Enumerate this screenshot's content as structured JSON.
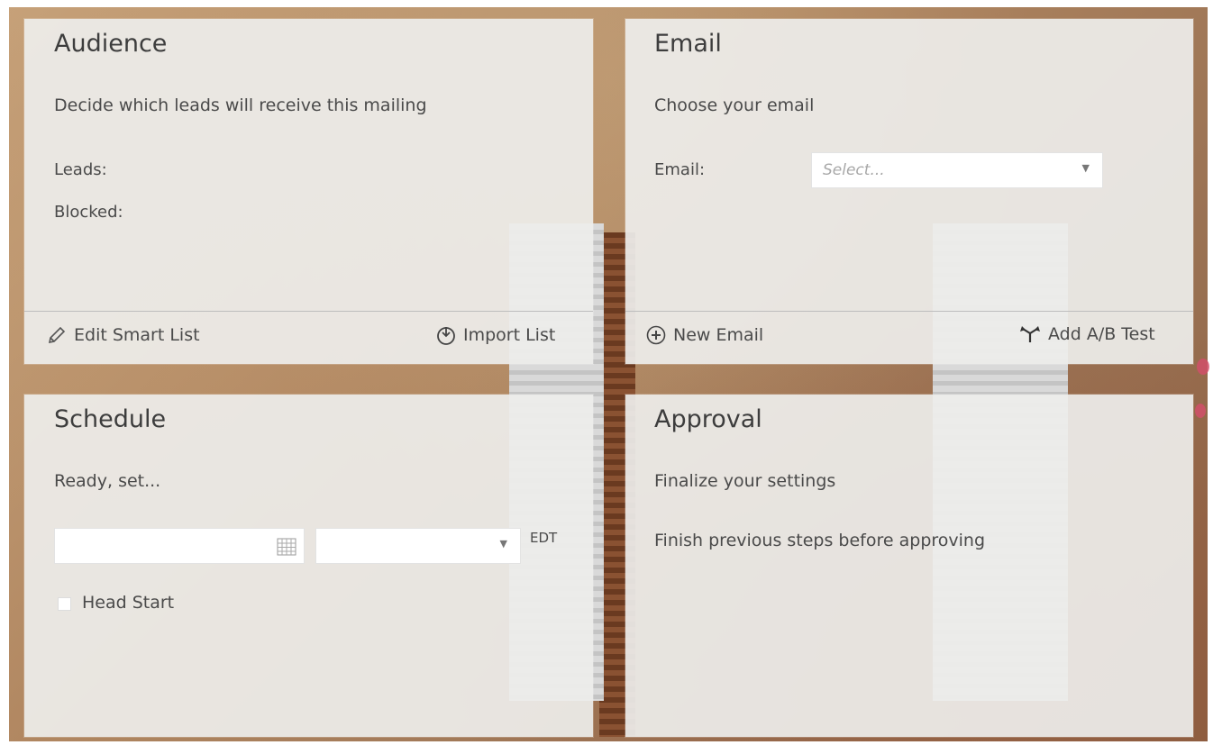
{
  "audience": {
    "title": "Audience",
    "subtitle": "Decide which leads will receive this mailing",
    "leads_label": "Leads:",
    "blocked_label": "Blocked:",
    "edit_smart_list": "Edit Smart List",
    "import_list": "Import List"
  },
  "email": {
    "title": "Email",
    "subtitle": "Choose your email",
    "email_label": "Email:",
    "select_placeholder": "Select...",
    "new_email": "New Email",
    "add_ab_test": "Add A/B Test"
  },
  "schedule": {
    "title": "Schedule",
    "subtitle": "Ready, set...",
    "date_value": "",
    "time_value": "",
    "timezone": "EDT",
    "head_start_label": "Head Start"
  },
  "approval": {
    "title": "Approval",
    "subtitle": "Finalize your settings",
    "message": "Finish previous steps before approving"
  },
  "icons": {
    "edit": "pencil-icon",
    "import": "import-icon",
    "new_email": "plus-circle-icon",
    "ab_test": "split-arrows-icon",
    "calendar": "calendar-icon",
    "caret": "chevron-down-icon"
  }
}
